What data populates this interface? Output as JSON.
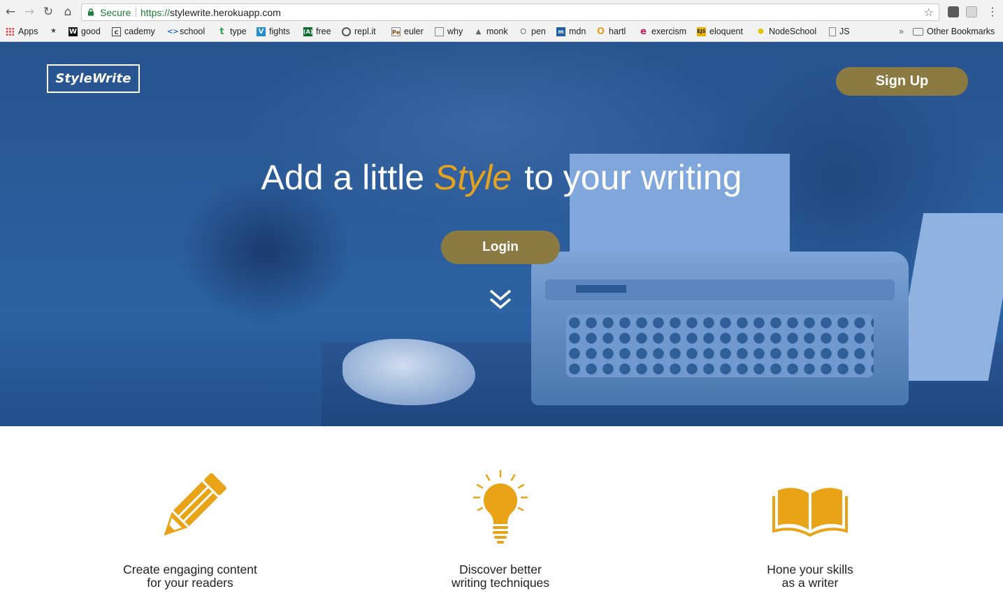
{
  "browser": {
    "secure_label": "Secure",
    "url_scheme": "https://",
    "url_host": "stylewrite.herokuapp.com",
    "bookmarks": [
      {
        "label": "Apps",
        "icon": "apps-grid-icon"
      },
      {
        "label": "good",
        "icon": "w-icon"
      },
      {
        "label": "cademy",
        "icon": "c-icon"
      },
      {
        "label": "school",
        "icon": "code-brackets-icon"
      },
      {
        "label": "type",
        "icon": "t-icon"
      },
      {
        "label": "fights",
        "icon": "v-icon"
      },
      {
        "label": "free",
        "icon": "fcc-icon"
      },
      {
        "label": "repl.it",
        "icon": "replit-icon"
      },
      {
        "label": "euler",
        "icon": "pe-icon"
      },
      {
        "label": "why",
        "icon": "doc-icon"
      },
      {
        "label": "monk",
        "icon": "monk-icon"
      },
      {
        "label": "pen",
        "icon": "codepen-icon"
      },
      {
        "label": "mdn",
        "icon": "mdn-icon"
      },
      {
        "label": "hartl",
        "icon": "o-icon"
      },
      {
        "label": "exercism",
        "icon": "exercism-icon"
      },
      {
        "label": "eloquent",
        "icon": "ejs-icon"
      },
      {
        "label": "NodeSchool",
        "icon": "hexagon-icon"
      },
      {
        "label": "JS",
        "icon": "page-icon"
      }
    ],
    "overflow_label": "»",
    "other_bookmarks": "Other Bookmarks"
  },
  "hero": {
    "logo": "StyleWrite",
    "signup_label": "Sign Up",
    "headline_before": "Add a little",
    "headline_accent": "Style",
    "headline_after": "to your writing",
    "login_label": "Login"
  },
  "features": [
    {
      "icon": "pencil-icon",
      "line1": "Create engaging content",
      "line2": "for your readers"
    },
    {
      "icon": "lightbulb-icon",
      "line1": "Discover better",
      "line2": "writing techniques"
    },
    {
      "icon": "open-book-icon",
      "line1": "Hone your skills",
      "line2": "as a writer"
    }
  ],
  "colors": {
    "accent": "#e5a21f",
    "hero_blue": "#2b5b9a",
    "button_gold": "#8c7a43"
  }
}
